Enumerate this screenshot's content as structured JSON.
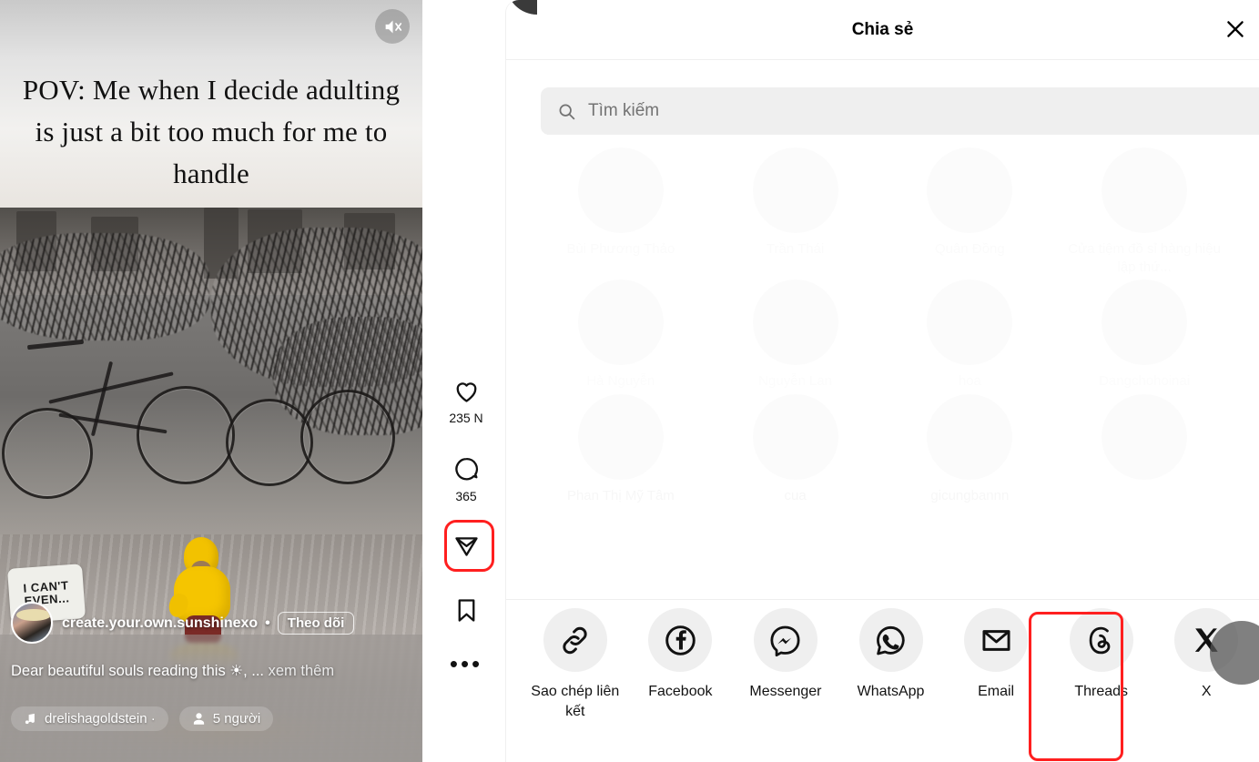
{
  "video": {
    "overlay_text": "POV: Me when I decide adulting is just a bit too much for me to handle",
    "mute_icon": "speaker-muted-icon",
    "sticker_line1": "I CAN'T",
    "sticker_line2": "EVEN...",
    "username": "create.your.own.sunshinexo",
    "separator": "•",
    "follow_label": "Theo dõi",
    "caption": "Dear beautiful souls reading this ☀, ...",
    "see_more": "xem thêm",
    "audio_label": "drelishagoldstein ·",
    "people_label": "5 người"
  },
  "rail": {
    "like_icon": "heart-icon",
    "like_count": "235 N",
    "comment_icon": "comment-icon",
    "comment_count": "365",
    "share_icon": "paper-plane-icon",
    "save_icon": "bookmark-icon",
    "more_icon": "ellipsis-icon",
    "more_label": "•••",
    "thumbnail": "profile-thumbnail"
  },
  "dialog": {
    "title": "Chia sẻ",
    "close_icon": "close-icon",
    "search": {
      "icon": "search-icon",
      "placeholder": "Tìm kiếm",
      "value": ""
    },
    "contacts": [
      [
        {
          "name": "Bùi Phương Thảo"
        },
        {
          "name": "Trần Thái"
        },
        {
          "name": "Quân Đồng"
        },
        {
          "name": "Cửa tiệm đồ sỉ hàng hiệu lập thứ..."
        }
      ],
      [
        {
          "name": "Hà Nguyễn"
        },
        {
          "name": "Nguyễn Lan"
        },
        {
          "name": "hoa"
        },
        {
          "name": "Dangchohoinai"
        }
      ],
      [
        {
          "name": "Phan Thị Mỹ Tâm"
        },
        {
          "name": "cua"
        },
        {
          "name": "gicungbannn"
        },
        {
          "name": ""
        }
      ]
    ],
    "share_targets": [
      {
        "label": "Sao chép liên kết",
        "icon": "link-icon"
      },
      {
        "label": "Facebook",
        "icon": "facebook-icon"
      },
      {
        "label": "Messenger",
        "icon": "messenger-icon"
      },
      {
        "label": "WhatsApp",
        "icon": "whatsapp-icon"
      },
      {
        "label": "Email",
        "icon": "email-icon"
      },
      {
        "label": "Threads",
        "icon": "threads-icon"
      },
      {
        "label": "X",
        "icon": "x-twitter-icon"
      }
    ]
  },
  "colors": {
    "highlight": "#ff1f1f",
    "chip_bg": "#efefef",
    "text_primary": "#121212",
    "text_muted": "#737373"
  }
}
